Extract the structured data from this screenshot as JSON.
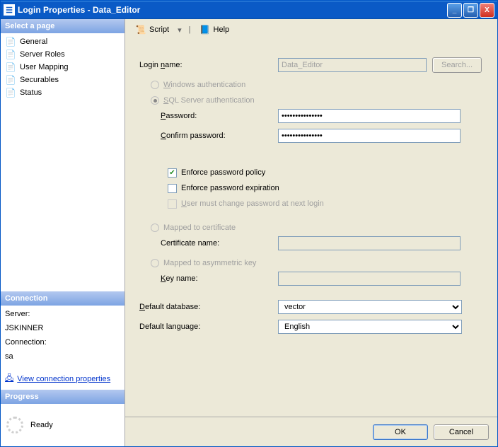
{
  "window": {
    "title": "Login Properties - Data_Editor",
    "min": "_",
    "max": "❐",
    "close": "X"
  },
  "sidebar": {
    "select_page": "Select a page",
    "items": [
      {
        "label": "General"
      },
      {
        "label": "Server Roles"
      },
      {
        "label": "User Mapping"
      },
      {
        "label": "Securables"
      },
      {
        "label": "Status"
      }
    ],
    "connection_hdr": "Connection",
    "server_label": "Server:",
    "server_value": "JSKINNER",
    "connection_label": "Connection:",
    "connection_value": "sa",
    "view_conn_link": "View connection properties",
    "progress_hdr": "Progress",
    "progress_status": "Ready"
  },
  "toolbar": {
    "script": "Script",
    "help": "Help"
  },
  "form": {
    "login_name_label": "Login name:",
    "login_name_value": "Data_Editor",
    "search_btn": "Search...",
    "windows_auth": "Windows authentication",
    "sql_auth": "SQL Server authentication",
    "password_label": "Password:",
    "password_value": "•••••••••••••••",
    "confirm_label": "Confirm password:",
    "confirm_value": "•••••••••••••••",
    "enforce_policy": "Enforce password policy",
    "enforce_expiration": "Enforce password expiration",
    "must_change": "User must change password at next login",
    "mapped_cert": "Mapped to certificate",
    "cert_name_label": "Certificate name:",
    "mapped_asym": "Mapped to asymmetric key",
    "key_name_label": "Key name:",
    "default_db_label": "Default database:",
    "default_db_value": "vector",
    "default_lang_label": "Default language:",
    "default_lang_value": "English"
  },
  "footer": {
    "ok": "OK",
    "cancel": "Cancel"
  }
}
